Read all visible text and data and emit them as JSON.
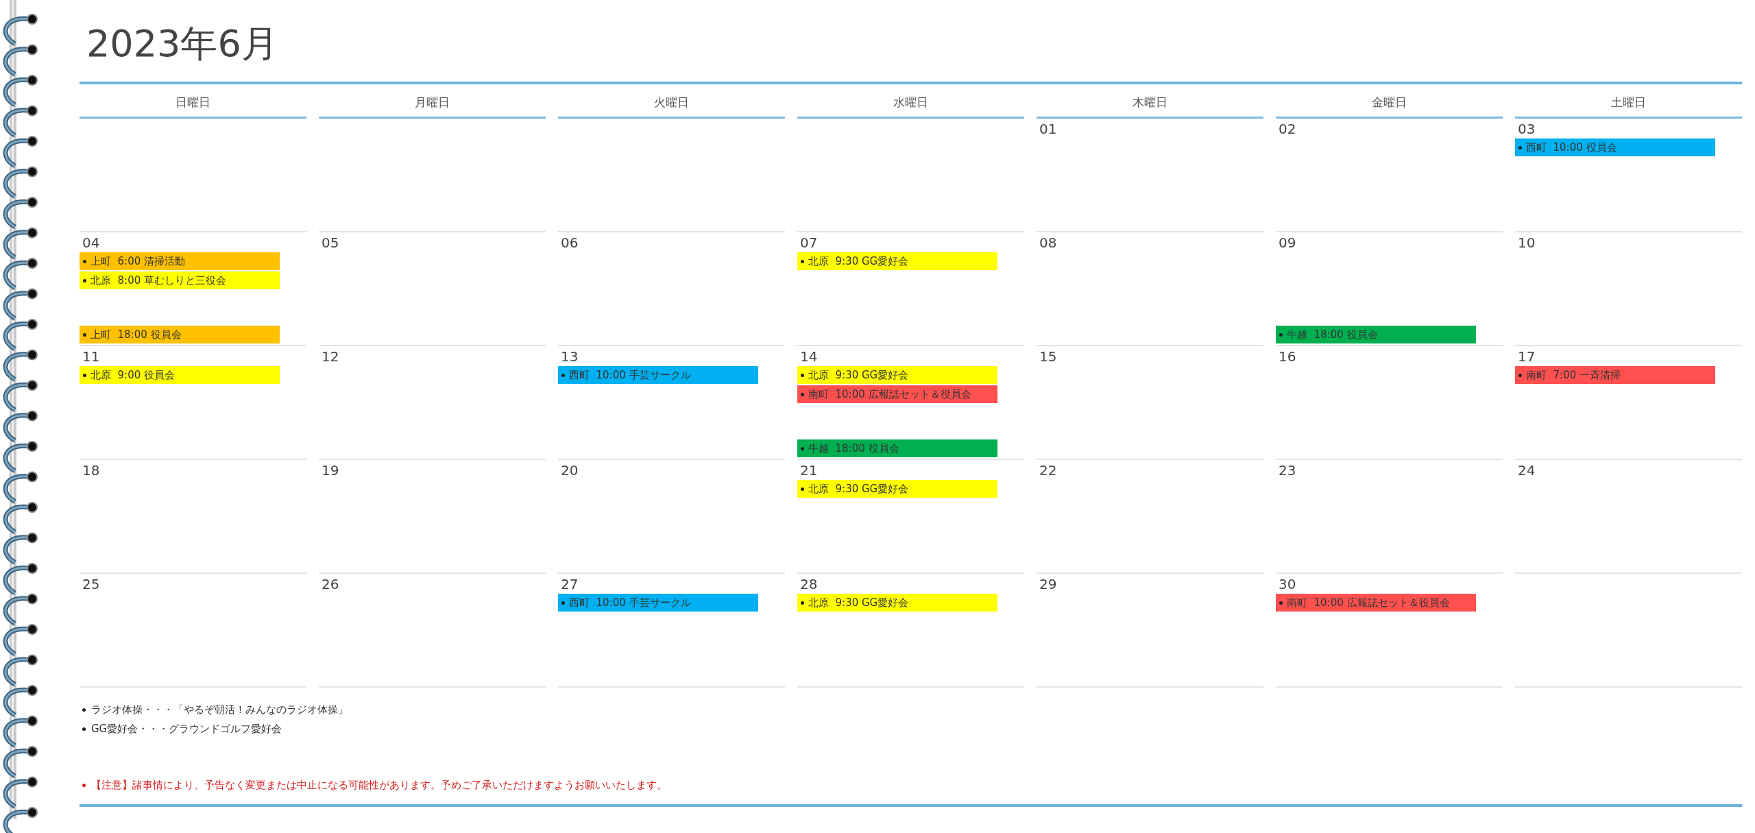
{
  "title": "2023年6月",
  "weekdays": [
    "日曜日",
    "月曜日",
    "火曜日",
    "水曜日",
    "木曜日",
    "金曜日",
    "土曜日"
  ],
  "weeks": [
    {
      "days": [
        {
          "kind": "blank"
        },
        {
          "kind": "blank"
        },
        {
          "kind": "blank"
        },
        {
          "kind": "blank"
        },
        {
          "kind": "day",
          "date": "01"
        },
        {
          "kind": "day",
          "date": "02"
        },
        {
          "kind": "day",
          "date": "03",
          "events": [
            {
              "text": "西町  10:00 役員会",
              "color": "#00b0f0"
            }
          ]
        }
      ]
    },
    {
      "days": [
        {
          "kind": "day",
          "date": "04",
          "events": [
            {
              "text": "上町  6:00 清掃活動",
              "color": "#ffc000"
            },
            {
              "text": "北原  8:00 草むしりと三役会",
              "color": "#ffff00"
            }
          ],
          "late_events": [
            {
              "text": "上町  18:00 役員会",
              "color": "#ffc000"
            }
          ]
        },
        {
          "kind": "day",
          "date": "05"
        },
        {
          "kind": "day",
          "date": "06"
        },
        {
          "kind": "day",
          "date": "07",
          "events": [
            {
              "text": "北原  9:30 GG愛好会",
              "color": "#ffff00"
            }
          ]
        },
        {
          "kind": "day",
          "date": "08"
        },
        {
          "kind": "day",
          "date": "09",
          "late_events": [
            {
              "text": "牛越  18:00 役員会",
              "color": "#00b050"
            }
          ]
        },
        {
          "kind": "day",
          "date": "10"
        }
      ]
    },
    {
      "days": [
        {
          "kind": "day",
          "date": "11",
          "events": [
            {
              "text": "北原  9:00 役員会",
              "color": "#ffff00"
            }
          ]
        },
        {
          "kind": "day",
          "date": "12"
        },
        {
          "kind": "day",
          "date": "13",
          "events": [
            {
              "text": "西町  10:00 手芸サークル",
              "color": "#00b0f0"
            }
          ]
        },
        {
          "kind": "day",
          "date": "14",
          "events": [
            {
              "text": "北原  9:30 GG愛好会",
              "color": "#ffff00"
            },
            {
              "text": "南町  10:00 広報誌セット＆役員会",
              "color": "#ff5050"
            }
          ],
          "late_events": [
            {
              "text": "牛越  18:00 役員会",
              "color": "#00b050"
            }
          ]
        },
        {
          "kind": "day",
          "date": "15"
        },
        {
          "kind": "day",
          "date": "16"
        },
        {
          "kind": "day",
          "date": "17",
          "events": [
            {
              "text": "南町  7:00 一斉清掃",
              "color": "#ff5050"
            }
          ]
        }
      ]
    },
    {
      "days": [
        {
          "kind": "day",
          "date": "18"
        },
        {
          "kind": "day",
          "date": "19"
        },
        {
          "kind": "day",
          "date": "20"
        },
        {
          "kind": "day",
          "date": "21",
          "events": [
            {
              "text": "北原  9:30 GG愛好会",
              "color": "#ffff00"
            }
          ]
        },
        {
          "kind": "day",
          "date": "22"
        },
        {
          "kind": "day",
          "date": "23"
        },
        {
          "kind": "day",
          "date": "24"
        }
      ]
    },
    {
      "days": [
        {
          "kind": "day",
          "date": "25"
        },
        {
          "kind": "day",
          "date": "26"
        },
        {
          "kind": "day",
          "date": "27",
          "events": [
            {
              "text": "西町  10:00 手芸サークル",
              "color": "#00b0f0"
            }
          ]
        },
        {
          "kind": "day",
          "date": "28",
          "events": [
            {
              "text": "北原  9:30 GG愛好会",
              "color": "#ffff00"
            }
          ]
        },
        {
          "kind": "day",
          "date": "29"
        },
        {
          "kind": "day",
          "date": "30",
          "events": [
            {
              "text": "南町  10:00 広報誌セット＆役員会",
              "color": "#ff5050"
            }
          ]
        },
        {
          "kind": "blank"
        }
      ]
    }
  ],
  "notes": [
    {
      "kind": "info",
      "text": "ラジオ体操・・・「やるぞ朝活！みんなのラジオ体操」"
    },
    {
      "kind": "info",
      "text": "GG愛好会・・・グラウンドゴルフ愛好会"
    },
    {
      "kind": "warning",
      "text": "【注意】諸事情により、予告なく変更または中止になる可能性があります。予めご了承いただけますようお願いいたします。"
    }
  ]
}
